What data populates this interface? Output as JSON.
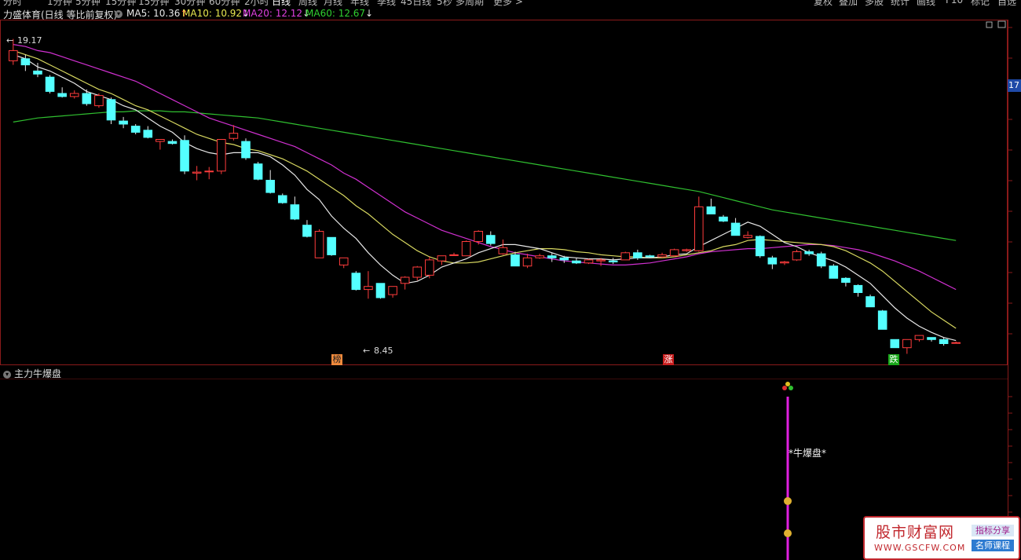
{
  "toolbar": {
    "left": [
      "分时",
      "1分钟",
      "5分钟",
      "15分钟",
      "15分钟",
      "30分钟",
      "60分钟",
      "2小时",
      "日线",
      "周线",
      "月线",
      "年线",
      "季线",
      "45日线",
      "5秒",
      "多周期",
      "更多 >"
    ],
    "right": [
      "复权",
      "叠加",
      "多股",
      "统计",
      "画线",
      "F10",
      "标记",
      "自选"
    ],
    "active_index": 8
  },
  "header": {
    "stock_name": "力盛体育",
    "mode": "(日线 等比前复权)",
    "ma": [
      {
        "label": "MA5: 10.36",
        "arrow": "↑",
        "color": "#e8e8e8",
        "arrow_color": "#ff3333"
      },
      {
        "label": "MA10: 10.92",
        "arrow": "↓",
        "color": "#e8e850",
        "arrow_color": "#e8e8e8"
      },
      {
        "label": "MA20: 12.12",
        "arrow": "↓",
        "color": "#e040e0",
        "arrow_color": "#e8e8e8"
      },
      {
        "label": "MA60: 12.67",
        "arrow": "↓",
        "color": "#30d030",
        "arrow_color": "#e8e8e8"
      }
    ]
  },
  "price_axis_tag": "17",
  "annotations": {
    "high": "19.17",
    "low": "8.45",
    "high_arrow": "←",
    "low_arrow": "←"
  },
  "markers": [
    {
      "text": "榜",
      "bg": "#f08a3c",
      "color": "#222"
    },
    {
      "text": "涨",
      "bg": "#c81e1e",
      "color": "#fff"
    },
    {
      "text": "跌",
      "bg": "#1aa81a",
      "color": "#fff"
    }
  ],
  "indicator": {
    "name": "主力牛爆盘",
    "signal_label": "*牛爆盘*"
  },
  "logo": {
    "main": "股市财富网",
    "url": "WWW.GSCFW.COM",
    "tag1": "指标分享",
    "tag2": "名师课程"
  },
  "chart_data": {
    "type": "candlestick",
    "ohlc": [
      [
        18.1,
        19.17,
        17.9,
        18.6
      ],
      [
        18.2,
        18.4,
        17.6,
        17.9
      ],
      [
        17.6,
        18.0,
        17.3,
        17.45
      ],
      [
        17.3,
        17.4,
        16.5,
        16.6
      ],
      [
        16.5,
        16.8,
        16.3,
        16.35
      ],
      [
        16.35,
        16.65,
        16.25,
        16.5
      ],
      [
        16.5,
        16.7,
        15.9,
        16.0
      ],
      [
        15.9,
        16.5,
        15.8,
        16.4
      ],
      [
        16.2,
        16.3,
        15.0,
        15.2
      ],
      [
        15.15,
        15.35,
        14.8,
        15.0
      ],
      [
        14.9,
        15.0,
        14.5,
        14.6
      ],
      [
        14.7,
        14.9,
        14.3,
        14.35
      ],
      [
        14.15,
        14.25,
        13.75,
        14.25
      ],
      [
        14.15,
        14.25,
        14.0,
        14.05
      ],
      [
        14.2,
        14.45,
        12.55,
        12.7
      ],
      [
        12.6,
        12.95,
        12.25,
        12.65
      ],
      [
        12.7,
        12.9,
        12.3,
        12.7
      ],
      [
        12.7,
        14.25,
        12.55,
        14.25
      ],
      [
        14.3,
        14.95,
        14.2,
        14.55
      ],
      [
        14.15,
        14.3,
        13.25,
        13.35
      ],
      [
        13.05,
        13.15,
        12.25,
        12.3
      ],
      [
        12.25,
        12.75,
        11.6,
        11.65
      ],
      [
        11.5,
        11.6,
        11.1,
        11.15
      ],
      [
        11.05,
        11.45,
        10.3,
        10.35
      ],
      [
        10.05,
        10.3,
        9.45,
        9.5
      ],
      [
        8.45,
        9.85,
        8.45,
        9.75
      ],
      [
        9.45,
        9.45,
        8.55,
        8.6
      ],
      [
        8.1,
        8.45,
        7.95,
        8.45
      ],
      [
        7.7,
        7.8,
        6.85,
        6.9
      ],
      [
        6.9,
        7.8,
        6.45,
        7.05
      ],
      [
        7.2,
        7.2,
        6.45,
        6.5
      ],
      [
        6.65,
        7.05,
        6.5,
        7.05
      ],
      [
        7.2,
        7.55,
        6.9,
        7.5
      ],
      [
        7.5,
        8.05,
        7.35,
        8.0
      ],
      [
        7.6,
        8.5,
        7.45,
        8.35
      ],
      [
        8.3,
        8.55,
        8.1,
        8.55
      ],
      [
        8.6,
        8.7,
        8.55,
        8.6
      ],
      [
        8.55,
        9.3,
        8.55,
        9.25
      ],
      [
        9.25,
        9.8,
        9.1,
        9.75
      ],
      [
        9.55,
        9.75,
        9.05,
        9.15
      ],
      [
        8.65,
        9.35,
        8.6,
        8.95
      ],
      [
        8.6,
        8.75,
        8.05,
        8.05
      ],
      [
        8.05,
        8.65,
        7.95,
        8.45
      ],
      [
        8.45,
        8.65,
        8.4,
        8.55
      ],
      [
        8.55,
        8.7,
        8.25,
        8.45
      ],
      [
        8.45,
        8.55,
        8.2,
        8.35
      ],
      [
        8.3,
        8.45,
        8.15,
        8.2
      ],
      [
        8.2,
        8.4,
        8.15,
        8.35
      ],
      [
        8.3,
        8.45,
        8.05,
        8.35
      ],
      [
        8.3,
        8.45,
        8.15,
        8.25
      ],
      [
        8.35,
        8.75,
        8.35,
        8.7
      ],
      [
        8.7,
        8.85,
        8.35,
        8.45
      ],
      [
        8.55,
        8.6,
        8.45,
        8.5
      ],
      [
        8.5,
        8.7,
        8.45,
        8.6
      ],
      [
        8.55,
        8.9,
        8.5,
        8.85
      ],
      [
        8.8,
        8.9,
        8.75,
        8.85
      ],
      [
        8.8,
        11.45,
        8.75,
        10.95
      ],
      [
        10.95,
        11.35,
        10.6,
        10.6
      ],
      [
        10.45,
        10.55,
        10.2,
        10.25
      ],
      [
        10.15,
        10.4,
        9.55,
        9.55
      ],
      [
        9.45,
        9.75,
        9.4,
        9.55
      ],
      [
        9.5,
        9.55,
        8.45,
        8.55
      ],
      [
        8.45,
        8.55,
        7.9,
        8.15
      ],
      [
        8.2,
        8.3,
        8.1,
        8.25
      ],
      [
        8.35,
        8.85,
        8.3,
        8.75
      ],
      [
        8.75,
        8.85,
        8.55,
        8.65
      ],
      [
        8.65,
        8.75,
        7.95,
        8.05
      ],
      [
        8.05,
        8.15,
        7.45,
        7.45
      ],
      [
        7.45,
        7.5,
        7.05,
        7.25
      ],
      [
        7.1,
        7.15,
        6.55,
        6.75
      ],
      [
        6.55,
        6.65,
        6.05,
        6.05
      ],
      [
        5.85,
        5.9,
        4.95,
        4.95
      ],
      [
        4.45,
        4.45,
        4.05,
        4.05
      ],
      [
        4.05,
        4.45,
        3.75,
        4.45
      ],
      [
        4.45,
        4.65,
        4.35,
        4.65
      ],
      [
        4.55,
        4.55,
        4.35,
        4.45
      ],
      [
        4.45,
        4.55,
        4.15,
        4.25
      ],
      [
        4.3,
        4.35,
        4.25,
        4.3
      ]
    ],
    "ma5": [
      18.4,
      18.2,
      17.8,
      17.6,
      17.3,
      17.0,
      16.6,
      16.4,
      16.2,
      15.9,
      15.7,
      15.3,
      14.9,
      14.6,
      14.1,
      13.8,
      13.6,
      13.5,
      13.6,
      13.6,
      13.6,
      13.4,
      13.0,
      12.5,
      11.8,
      11.3,
      10.5,
      9.9,
      9.4,
      8.7,
      8.1,
      7.6,
      7.2,
      7.3,
      7.6,
      8.0,
      8.2,
      8.4,
      8.7,
      8.9,
      9.1,
      9.1,
      9.0,
      8.9,
      8.7,
      8.5,
      8.45,
      8.4,
      8.4,
      8.35,
      8.4,
      8.45,
      8.45,
      8.5,
      8.6,
      8.65,
      9.0,
      9.3,
      9.6,
      9.9,
      10.2,
      10.0,
      9.6,
      9.2,
      9.0,
      8.7,
      8.5,
      8.3,
      8.0,
      7.6,
      7.2,
      6.6,
      6.0,
      5.5,
      5.1,
      4.8,
      4.55,
      4.4
    ],
    "ma10": [
      18.6,
      18.4,
      18.2,
      17.9,
      17.6,
      17.3,
      17.0,
      16.7,
      16.5,
      16.2,
      15.9,
      15.7,
      15.4,
      15.1,
      14.8,
      14.5,
      14.3,
      14.1,
      14.0,
      13.8,
      13.7,
      13.5,
      13.3,
      13.0,
      12.7,
      12.3,
      11.9,
      11.5,
      11.0,
      10.6,
      10.1,
      9.6,
      9.2,
      8.8,
      8.5,
      8.3,
      8.2,
      8.2,
      8.25,
      8.4,
      8.55,
      8.7,
      8.8,
      8.9,
      8.9,
      8.85,
      8.75,
      8.7,
      8.6,
      8.55,
      8.5,
      8.5,
      8.45,
      8.45,
      8.5,
      8.6,
      8.7,
      8.8,
      9.0,
      9.1,
      9.3,
      9.35,
      9.3,
      9.25,
      9.2,
      9.15,
      9.1,
      9.0,
      8.8,
      8.5,
      8.2,
      7.8,
      7.3,
      6.8,
      6.3,
      5.8,
      5.4,
      5.0
    ],
    "ma20": [
      18.9,
      18.8,
      18.6,
      18.5,
      18.3,
      18.1,
      17.9,
      17.7,
      17.5,
      17.3,
      17.1,
      16.8,
      16.5,
      16.2,
      15.9,
      15.6,
      15.3,
      15.1,
      14.9,
      14.7,
      14.5,
      14.3,
      14.1,
      13.9,
      13.6,
      13.3,
      13.0,
      12.6,
      12.3,
      11.9,
      11.5,
      11.1,
      10.7,
      10.4,
      10.1,
      9.8,
      9.6,
      9.4,
      9.2,
      9.0,
      8.85,
      8.7,
      8.6,
      8.5,
      8.4,
      8.3,
      8.25,
      8.2,
      8.15,
      8.1,
      8.1,
      8.15,
      8.2,
      8.3,
      8.4,
      8.5,
      8.65,
      8.75,
      8.8,
      8.85,
      8.9,
      8.9,
      8.95,
      9.0,
      9.05,
      9.1,
      9.1,
      9.05,
      8.95,
      8.85,
      8.7,
      8.5,
      8.3,
      8.05,
      7.8,
      7.5,
      7.2,
      6.9
    ],
    "ma60": [
      15.1,
      15.2,
      15.3,
      15.35,
      15.4,
      15.45,
      15.5,
      15.55,
      15.6,
      15.6,
      15.65,
      15.65,
      15.65,
      15.6,
      15.6,
      15.55,
      15.5,
      15.45,
      15.4,
      15.35,
      15.3,
      15.2,
      15.1,
      15.0,
      14.9,
      14.8,
      14.7,
      14.6,
      14.5,
      14.4,
      14.3,
      14.2,
      14.1,
      14.0,
      13.9,
      13.8,
      13.7,
      13.6,
      13.5,
      13.4,
      13.3,
      13.2,
      13.1,
      13.0,
      12.9,
      12.8,
      12.7,
      12.6,
      12.5,
      12.4,
      12.3,
      12.2,
      12.1,
      12.0,
      11.9,
      11.8,
      11.7,
      11.55,
      11.4,
      11.25,
      11.1,
      10.95,
      10.8,
      10.7,
      10.6,
      10.5,
      10.4,
      10.3,
      10.2,
      10.1,
      10.0,
      9.9,
      9.8,
      9.7,
      9.6,
      9.5,
      9.4,
      9.3
    ],
    "high_value": 19.17,
    "low_value": 8.45,
    "ylim": [
      3.0,
      20.0
    ]
  }
}
